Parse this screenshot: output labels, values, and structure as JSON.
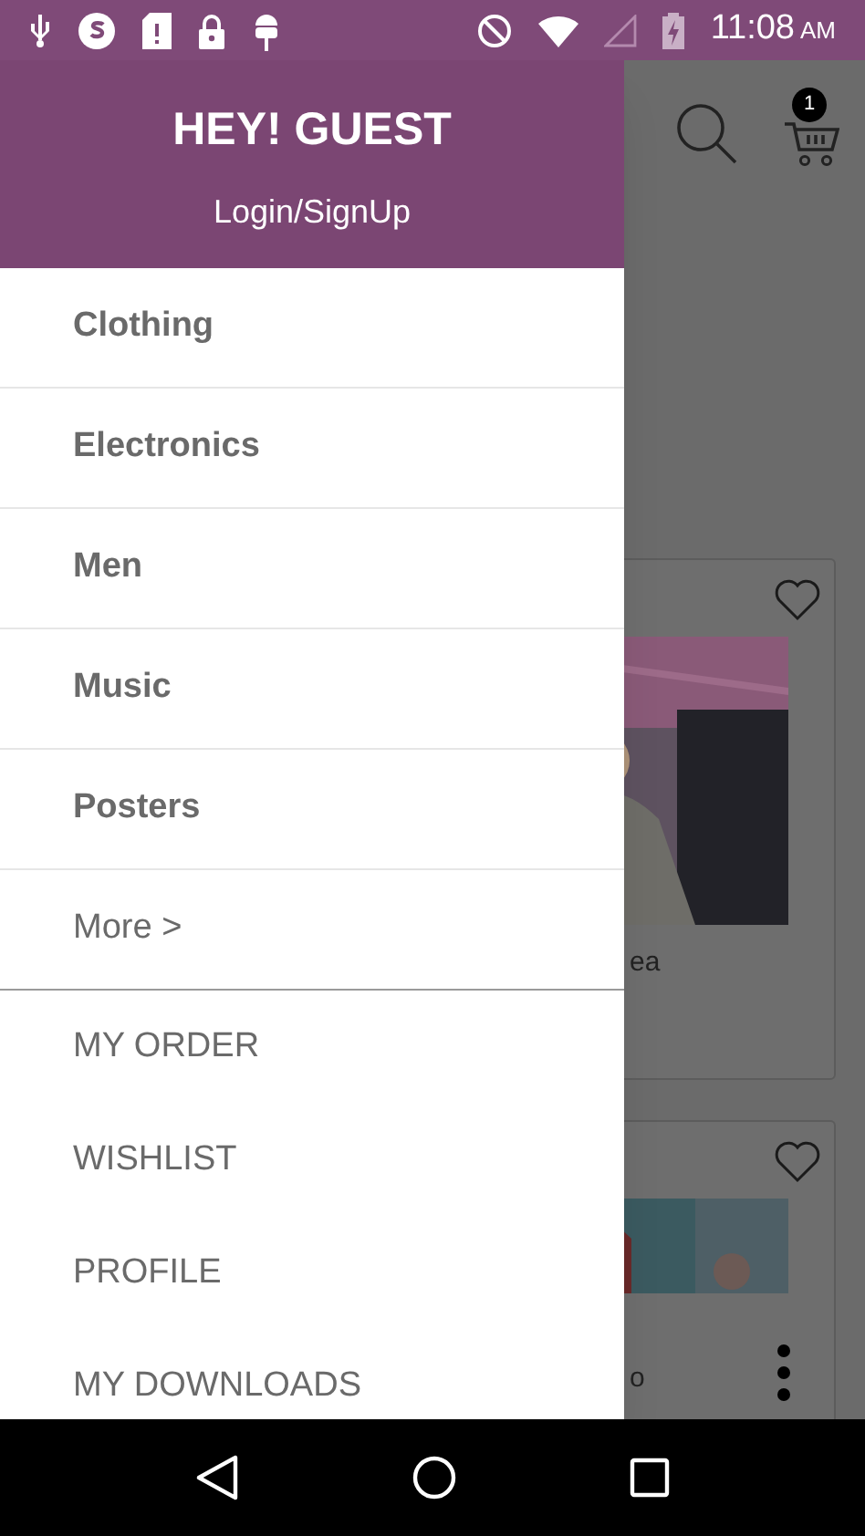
{
  "status_bar": {
    "time": "11:08",
    "meridiem": "AM"
  },
  "drawer": {
    "greeting": "HEY! GUEST",
    "login": "Login/SignUp",
    "categories": [
      {
        "label": "Clothing"
      },
      {
        "label": "Electronics"
      },
      {
        "label": "Men"
      },
      {
        "label": "Music"
      },
      {
        "label": "Posters"
      }
    ],
    "more": "More >",
    "account_items": [
      {
        "label": "MY ORDER"
      },
      {
        "label": "WISHLIST"
      },
      {
        "label": "PROFILE"
      },
      {
        "label": "MY DOWNLOADS"
      }
    ]
  },
  "app_bar": {
    "cart_count": "1"
  },
  "products": [
    {
      "caption": "ea"
    },
    {
      "caption": "o"
    }
  ]
}
